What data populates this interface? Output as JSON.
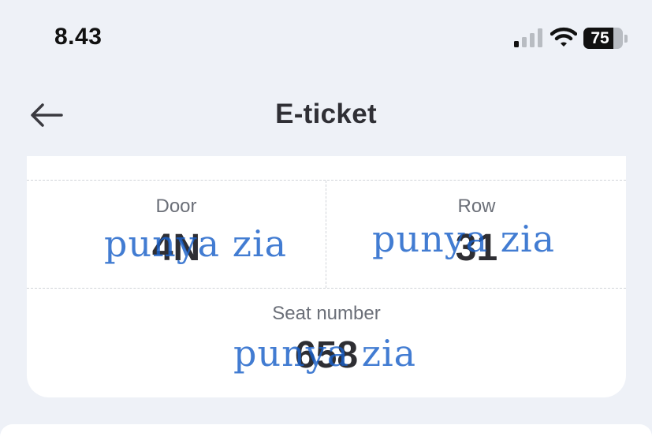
{
  "status_bar": {
    "time": "8.43",
    "battery": "75",
    "battery_level": 0.75,
    "icons": [
      "signal-icon",
      "wifi-icon",
      "battery-icon"
    ]
  },
  "header": {
    "title": "E-ticket",
    "back_icon": "arrow-left-icon"
  },
  "ticket": {
    "door": {
      "label": "Door",
      "value": "4N"
    },
    "row": {
      "label": "Row",
      "value": "31"
    },
    "seat": {
      "label": "Seat number",
      "value": "658"
    },
    "watermark": "punya zia"
  },
  "colors": {
    "background": "#eef1f7",
    "card": "#ffffff",
    "watermark": "#1f5fc8",
    "value_text": "#2e2e33"
  }
}
